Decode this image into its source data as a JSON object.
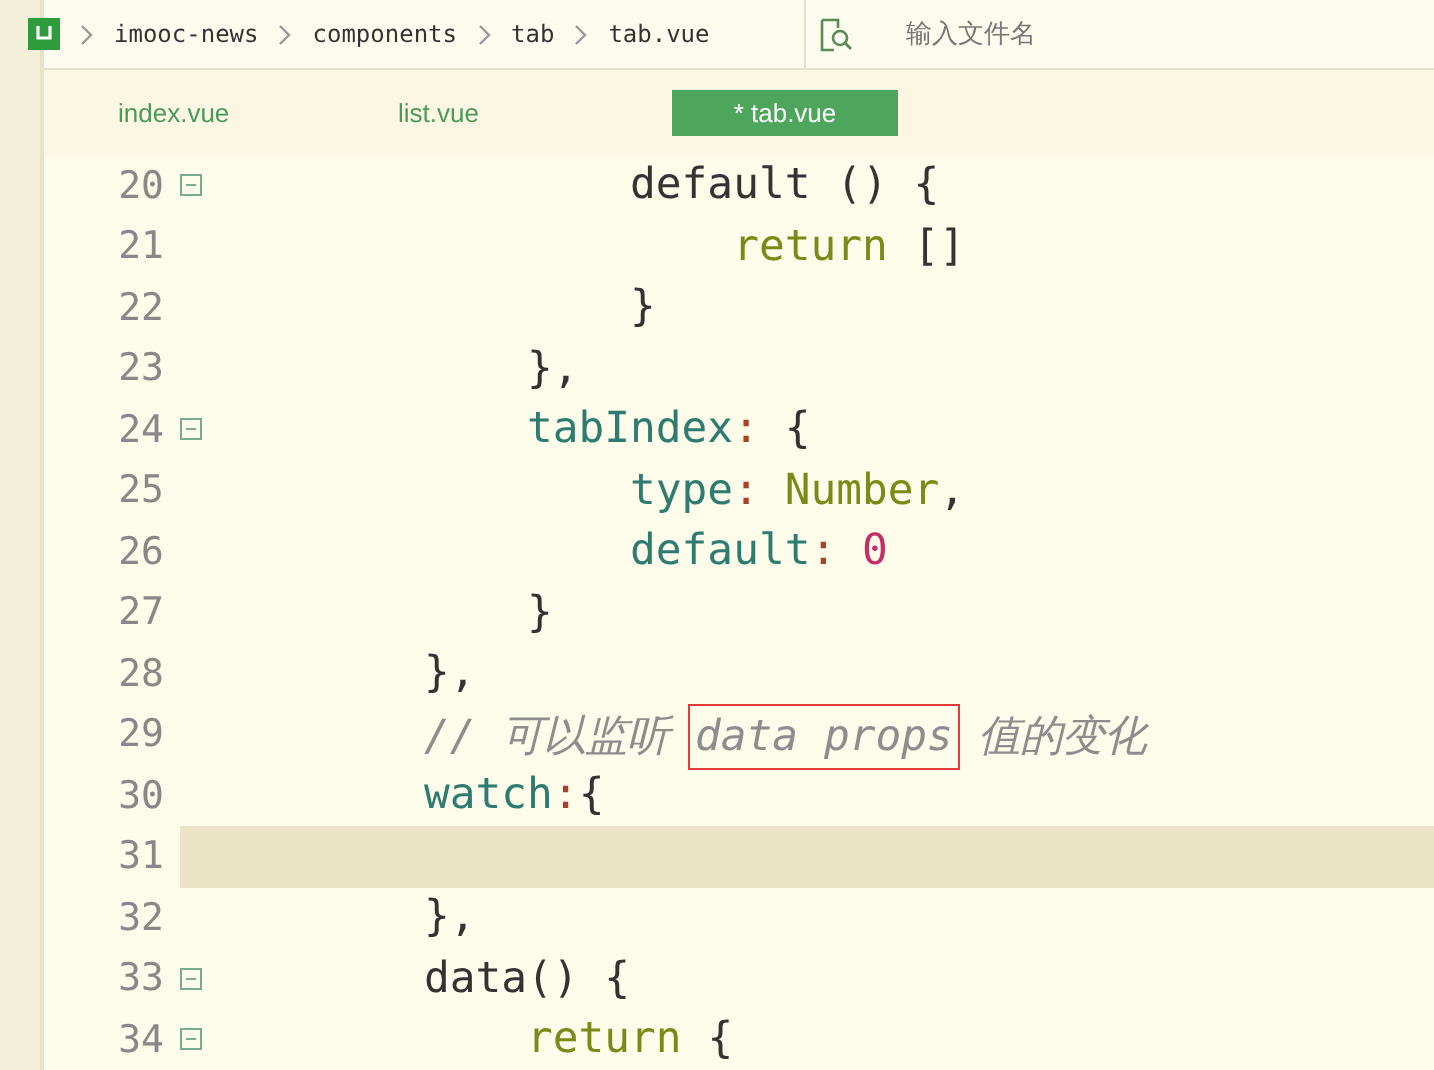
{
  "breadcrumb": [
    "imooc-news",
    "components",
    "tab",
    "tab.vue"
  ],
  "search": {
    "placeholder": "输入文件名"
  },
  "tabs": [
    {
      "label": "index.vue",
      "selected": false
    },
    {
      "label": "list.vue",
      "selected": false
    },
    {
      "label": "* tab.vue",
      "selected": true
    }
  ],
  "lines": [
    {
      "number": "20",
      "foldable": true,
      "current": false,
      "tokens": [
        {
          "text": "                default () {",
          "kind": "plain"
        }
      ]
    },
    {
      "number": "21",
      "foldable": false,
      "current": false,
      "tokens": [
        {
          "text": "                    return",
          "kind": "keyword"
        },
        {
          "text": " []",
          "kind": "plain"
        }
      ]
    },
    {
      "number": "22",
      "foldable": false,
      "current": false,
      "tokens": [
        {
          "text": "                }",
          "kind": "plain"
        }
      ]
    },
    {
      "number": "23",
      "foldable": false,
      "current": false,
      "tokens": [
        {
          "text": "            },",
          "kind": "plain"
        }
      ]
    },
    {
      "number": "24",
      "foldable": true,
      "current": false,
      "tokens": [
        {
          "text": "            tabIndex",
          "kind": "prop"
        },
        {
          "text": ":",
          "kind": "punct"
        },
        {
          "text": " {",
          "kind": "plain"
        }
      ]
    },
    {
      "number": "25",
      "foldable": false,
      "current": false,
      "tokens": [
        {
          "text": "                type",
          "kind": "prop"
        },
        {
          "text": ":",
          "kind": "punct"
        },
        {
          "text": " Number",
          "kind": "keyword"
        },
        {
          "text": ",",
          "kind": "plain"
        }
      ]
    },
    {
      "number": "26",
      "foldable": false,
      "current": false,
      "tokens": [
        {
          "text": "                default",
          "kind": "prop"
        },
        {
          "text": ":",
          "kind": "punct"
        },
        {
          "text": " 0",
          "kind": "number"
        }
      ]
    },
    {
      "number": "27",
      "foldable": false,
      "current": false,
      "tokens": [
        {
          "text": "            }",
          "kind": "plain"
        }
      ]
    },
    {
      "number": "28",
      "foldable": false,
      "current": false,
      "tokens": [
        {
          "text": "        },",
          "kind": "plain"
        }
      ]
    },
    {
      "number": "29",
      "foldable": false,
      "current": false,
      "tokens": [
        {
          "text": "        // 可以监听 ",
          "kind": "comment"
        },
        {
          "text": "data props",
          "kind": "boxed"
        },
        {
          "text": " 值的变化",
          "kind": "comment"
        }
      ]
    },
    {
      "number": "30",
      "foldable": false,
      "current": false,
      "tokens": [
        {
          "text": "        watch",
          "kind": "prop"
        },
        {
          "text": ":",
          "kind": "punct"
        },
        {
          "text": "{",
          "kind": "plain"
        }
      ]
    },
    {
      "number": "31",
      "foldable": false,
      "current": true
    },
    {
      "number": "32",
      "foldable": false,
      "current": false,
      "tokens": [
        {
          "text": "        },",
          "kind": "plain"
        }
      ]
    },
    {
      "number": "33",
      "foldable": true,
      "current": false,
      "tokens": [
        {
          "text": "        data() {",
          "kind": "plain"
        }
      ]
    },
    {
      "number": "34",
      "foldable": true,
      "current": false,
      "tokens": [
        {
          "text": "            return",
          "kind": "keyword"
        },
        {
          "text": " {",
          "kind": "plain"
        }
      ]
    }
  ]
}
